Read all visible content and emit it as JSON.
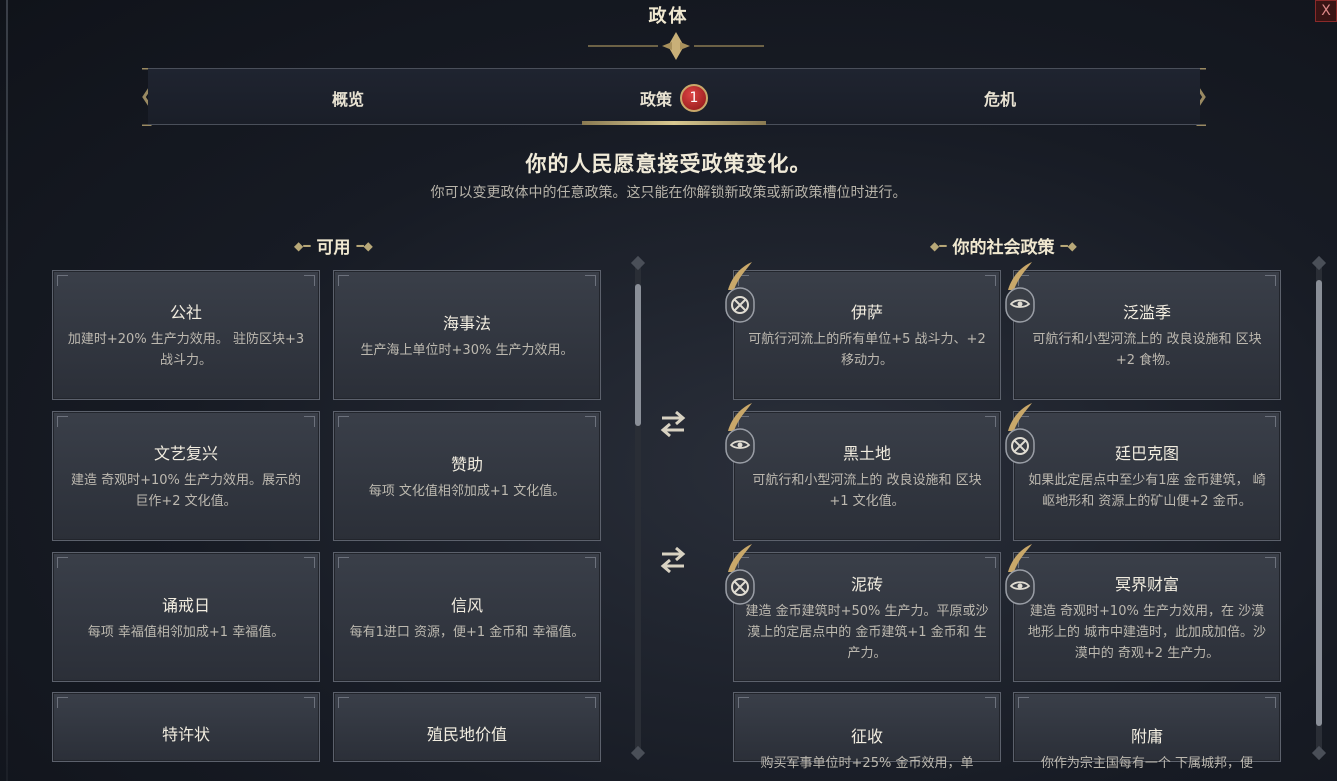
{
  "window": {
    "title": "政体",
    "close_label": "X"
  },
  "tabs": [
    {
      "label": "概览"
    },
    {
      "label": "政策",
      "badge": "1"
    },
    {
      "label": "危机"
    }
  ],
  "header": {
    "headline": "你的人民愿意接受政策变化。",
    "subline": "你可以变更政体中的任意政策。这只能在你解锁新政策或新政策槽位时进行。"
  },
  "available": {
    "title": "可用",
    "cards": [
      {
        "title": "公社",
        "desc": "加建时+20% 生产力效用。 驻防区块+3 战斗力。"
      },
      {
        "title": "海事法",
        "desc": "生产海上单位时+30% 生产力效用。"
      },
      {
        "title": "文艺复兴",
        "desc": "建造 奇观时+10% 生产力效用。展示的 巨作+2 文化值。"
      },
      {
        "title": "赞助",
        "desc": "每项 文化值相邻加成+1 文化值。"
      },
      {
        "title": "诵戒日",
        "desc": "每项 幸福值相邻加成+1 幸福值。"
      },
      {
        "title": "信风",
        "desc": "每有1进口 资源，便+1 金币和 幸福值。"
      },
      {
        "title": "特许状",
        "desc": ""
      },
      {
        "title": "殖民地价值",
        "desc": ""
      }
    ]
  },
  "social": {
    "title": "你的社会政策",
    "cards": [
      {
        "title": "伊萨",
        "desc": "可航行河流上的所有单位+5 战斗力、+2 移动力。",
        "icon": "quill-wheel-icon"
      },
      {
        "title": "泛滥季",
        "desc": "可航行和小型河流上的 改良设施和 区块+2 食物。",
        "icon": "quill-eye-icon"
      },
      {
        "title": "黑土地",
        "desc": "可航行和小型河流上的 改良设施和 区块+1 文化值。",
        "icon": "quill-eye-icon"
      },
      {
        "title": "廷巴克图",
        "desc": "如果此定居点中至少有1座 金币建筑， 崎岖地形和 资源上的矿山便+2 金币。",
        "icon": "quill-wheel-icon"
      },
      {
        "title": "泥砖",
        "desc": "建造 金币建筑时+50% 生产力。平原或沙漠上的定居点中的 金币建筑+1 金币和 生产力。",
        "icon": "quill-wheel-icon"
      },
      {
        "title": "冥界财富",
        "desc": "建造 奇观时+10% 生产力效用，在 沙漠地形上的 城市中建造时，此加成加倍。沙漠中的 奇观+2 生产力。",
        "icon": "quill-eye-icon"
      },
      {
        "title": "征收",
        "desc": "购买军事单位时+25% 金币效用，单",
        "icon": ""
      },
      {
        "title": "附庸",
        "desc": "你作为宗主国每有一个 下属城邦，便",
        "icon": ""
      }
    ]
  },
  "colors": {
    "accent_gold": "#c9a86a",
    "badge_red": "#b32222",
    "card_bg": "#343842"
  }
}
